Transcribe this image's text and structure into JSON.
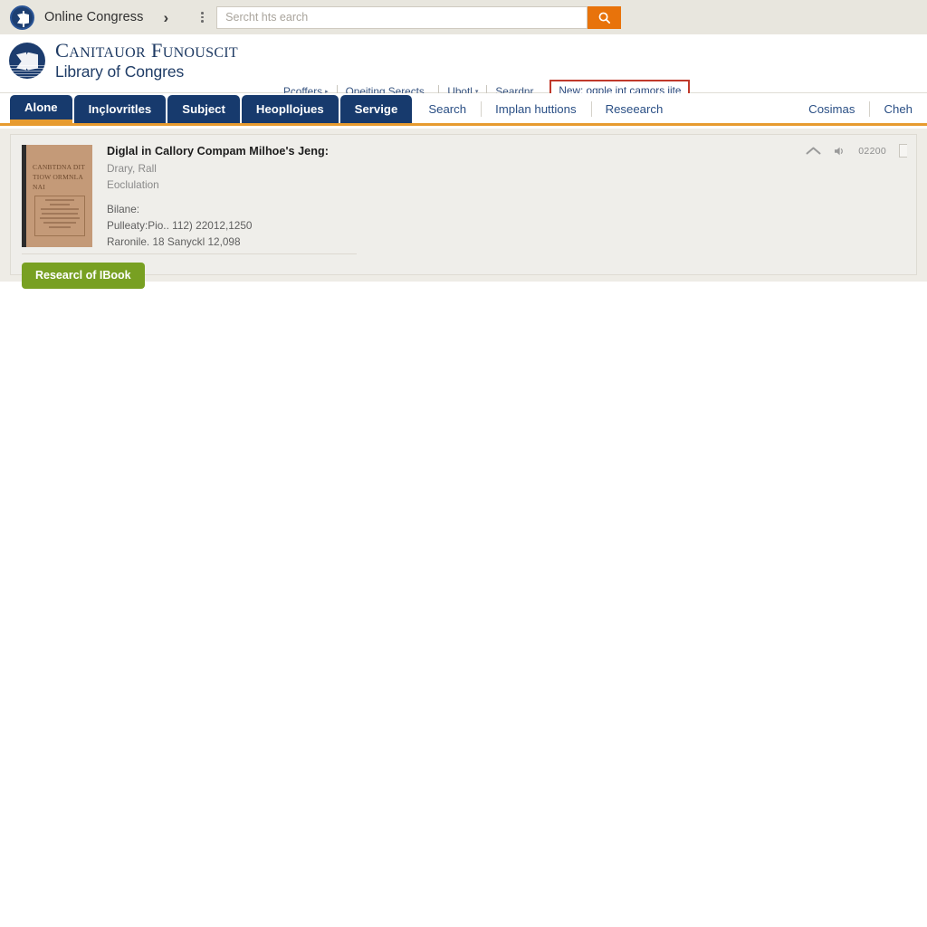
{
  "browser": {
    "site_label": "Online Congress",
    "chevron": "›",
    "menu_icon": "kebab-menu-icon",
    "search_placeholder": "Sercht hts earch",
    "search_value": "",
    "search_button_icon": "search-icon",
    "search_button_color": "#e8730b",
    "bar_color": "#e8e6de"
  },
  "header": {
    "logo_icon": "library-seal-icon",
    "brand_line1": "Canitauor Funouscit",
    "brand_line2": "Library of Congres",
    "brand_color": "#1e3a63",
    "utility_nav": [
      {
        "label": "Pcoffers",
        "has_caret": true
      },
      {
        "label": "Opeiting Serects ,",
        "has_caret": false
      },
      {
        "label": "Ubotl",
        "has_caret": true
      },
      {
        "label": "Seardnr",
        "has_caret": false
      }
    ],
    "highlight_link": {
      "label": "New: ogple int camors iite",
      "outline_color": "#c0392b"
    }
  },
  "main_nav": {
    "active_index": 0,
    "accent_color": "#e79b2f",
    "tab_color": "#173a6d",
    "tabs": [
      {
        "label": "Alone"
      },
      {
        "label": "Inçlovritles"
      },
      {
        "label": "Subject"
      },
      {
        "label": "Heopllojues"
      },
      {
        "label": "Servige"
      }
    ],
    "links": [
      {
        "label": "Search"
      },
      {
        "label": "Implan huttions"
      },
      {
        "label": "Reseearch"
      }
    ],
    "right_links": [
      {
        "label": "Cosimas"
      },
      {
        "label": "Cheh"
      }
    ]
  },
  "content": {
    "background": "#eeece6",
    "result": {
      "thumbnail": {
        "icon": "book-cover-thumbnail",
        "cover_text": "CANBTDNA DITTIOW ORMNLANAI",
        "cover_color": "#c49a78"
      },
      "title": "Diglal in Callory Compam Milhoe's Jeng:",
      "subtitle_lines": [
        "Drary, Rall",
        "Eoclulation"
      ],
      "meta_lines": [
        "Bilane:",
        "Pulleaty:Pio.. 112) 22012,1250",
        "Raronile.  18 Sanyckl 12,098"
      ],
      "action_button": {
        "label": "Researcl of IBook",
        "color": "#78a022"
      },
      "tools": {
        "collapse_icon": "chevron-up-icon",
        "audio_icon": "speaker-icon",
        "count": "02200"
      }
    }
  }
}
